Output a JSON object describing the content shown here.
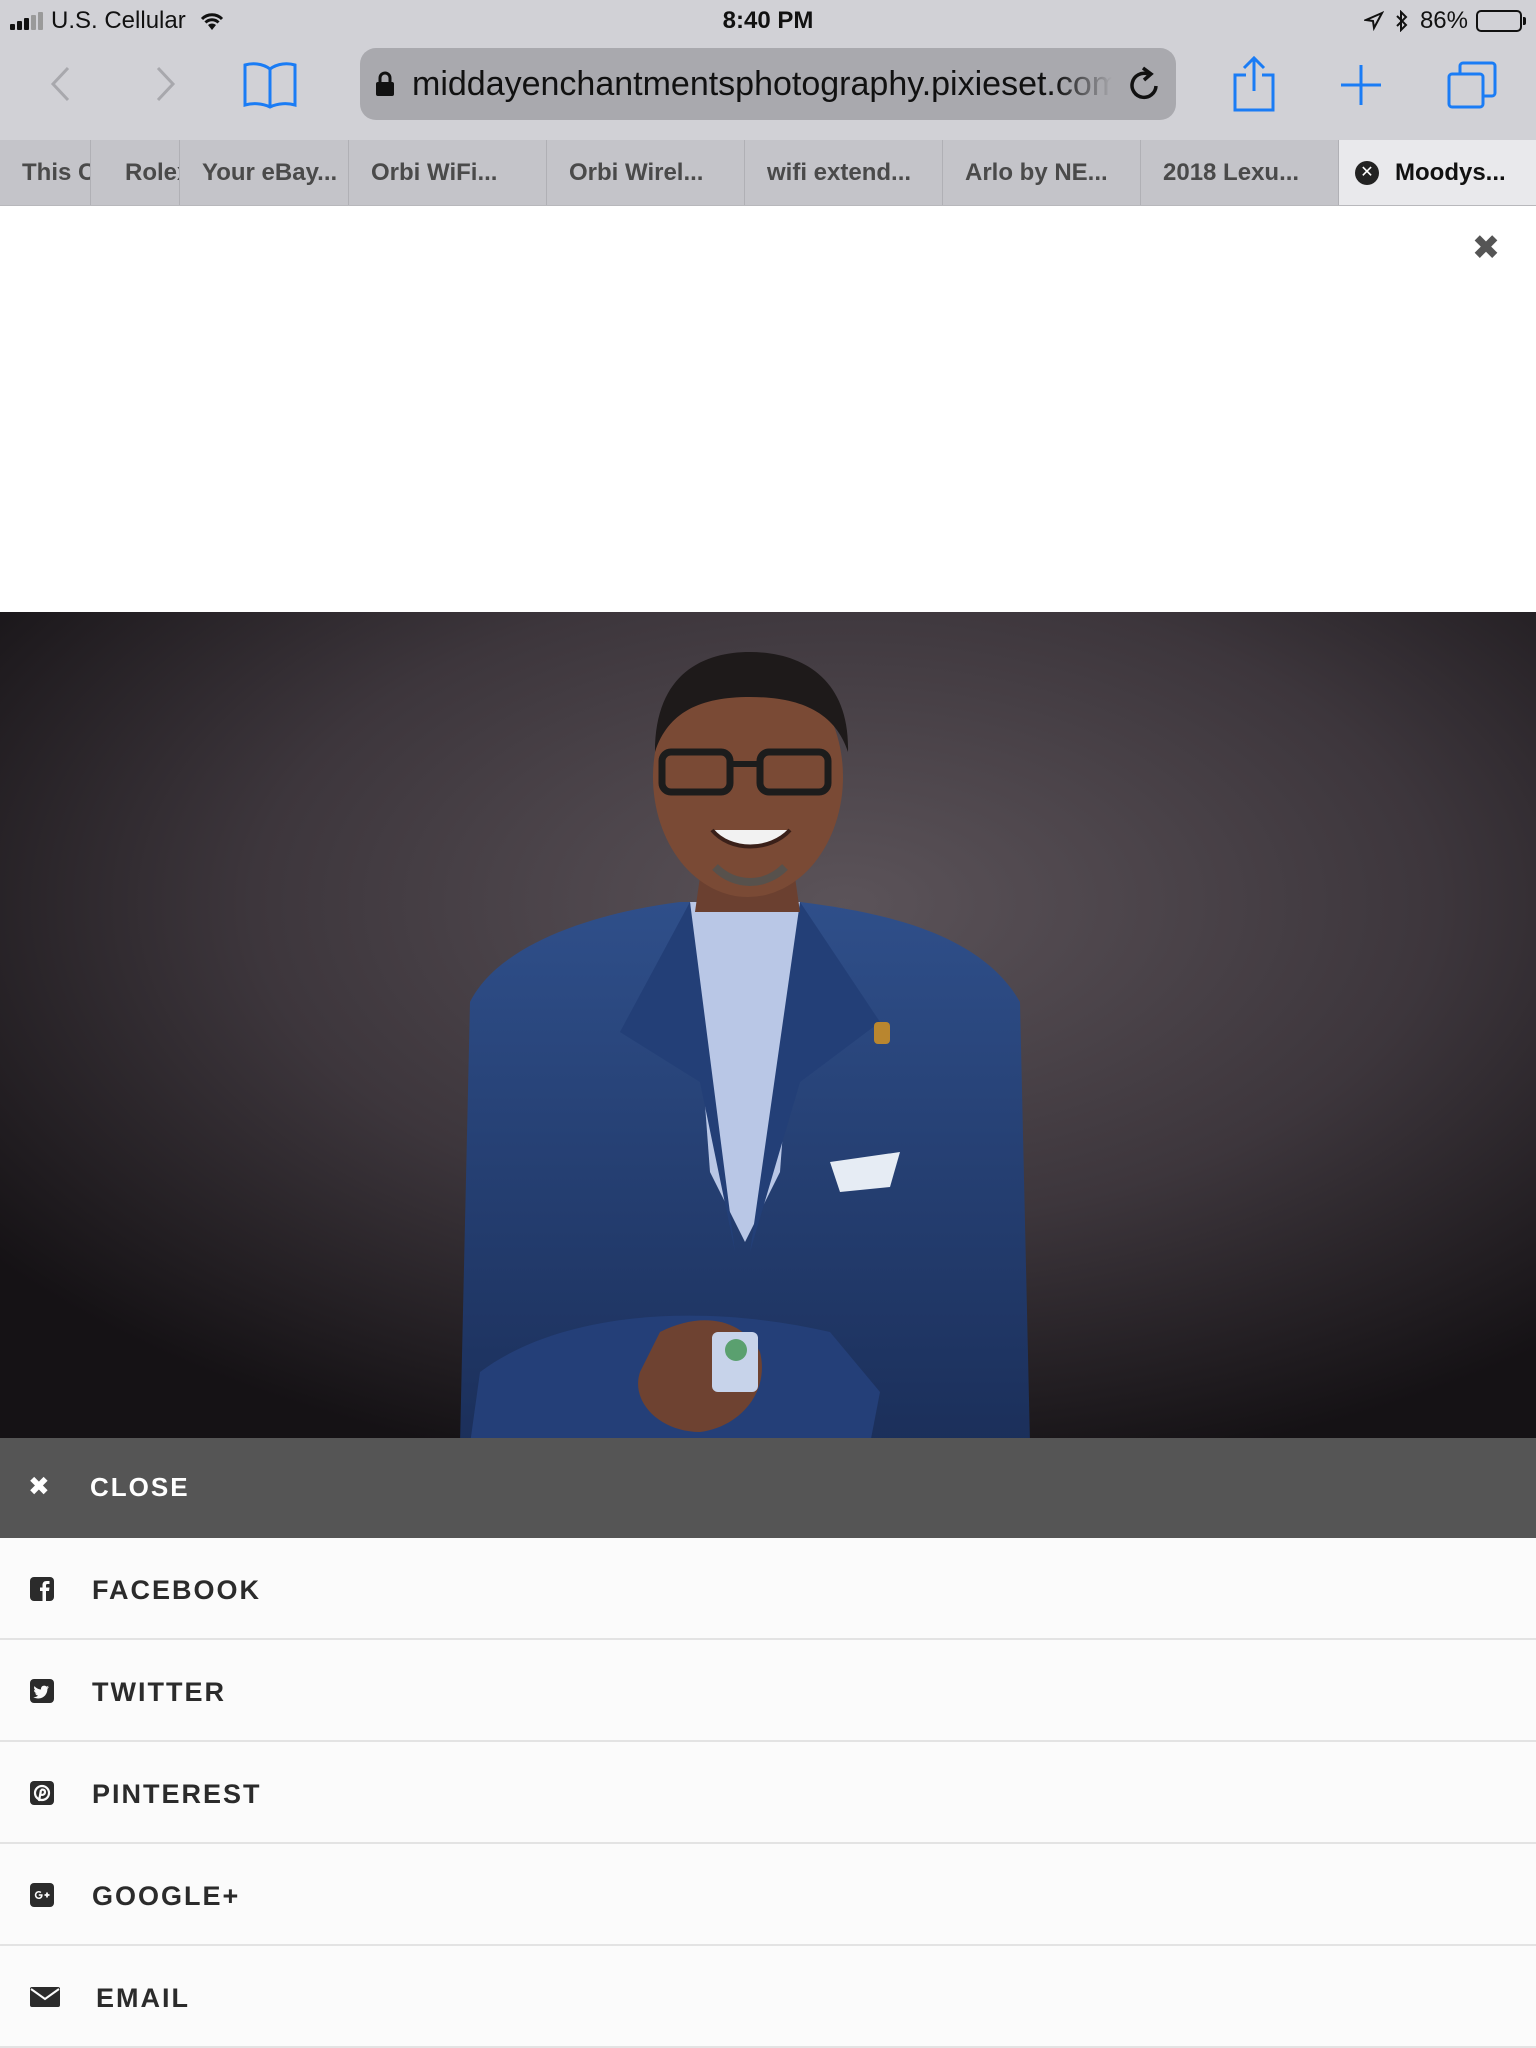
{
  "status_bar": {
    "carrier": "U.S. Cellular",
    "time": "8:40 PM",
    "battery": "86%",
    "battery_level": 0.86
  },
  "browser": {
    "url": "middayenchantmentsphotography.pixieset.com",
    "tabs": [
      {
        "label": "This C"
      },
      {
        "label": "Rolex"
      },
      {
        "label": "Your eBay..."
      },
      {
        "label": "Orbi WiFi..."
      },
      {
        "label": "Orbi Wirel..."
      },
      {
        "label": "wifi extend..."
      },
      {
        "label": "Arlo by NE..."
      },
      {
        "label": "2018 Lexu..."
      },
      {
        "label": "Moodys..."
      }
    ]
  },
  "share": {
    "close_label": "CLOSE",
    "items": [
      {
        "label": "FACEBOOK",
        "icon": "facebook-icon"
      },
      {
        "label": "TWITTER",
        "icon": "twitter-icon"
      },
      {
        "label": "PINTEREST",
        "icon": "pinterest-icon"
      },
      {
        "label": "GOOGLE+",
        "icon": "google-plus-icon"
      },
      {
        "label": "EMAIL",
        "icon": "email-icon"
      }
    ]
  },
  "colors": {
    "accent": "#1a7cf5",
    "share_header": "#555555",
    "share_row": "#fbfbfb"
  }
}
